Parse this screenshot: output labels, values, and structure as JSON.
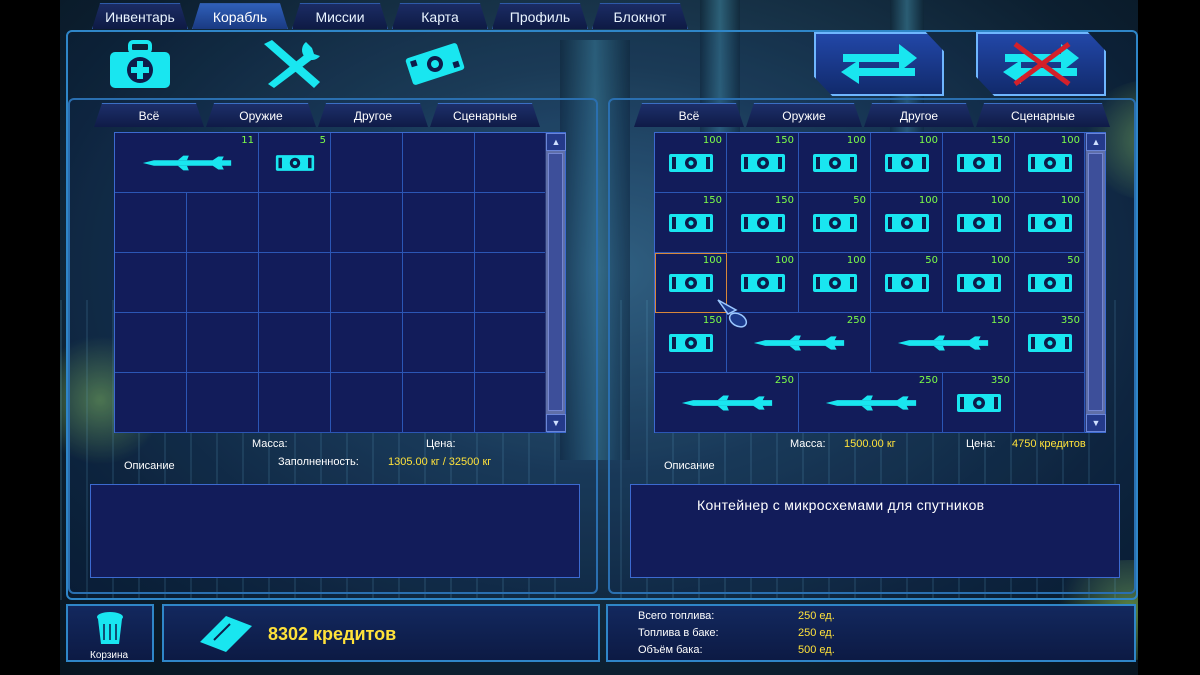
{
  "tabs": [
    "Инвентарь",
    "Корабль",
    "Миссии",
    "Карта",
    "Профиль",
    "Блокнот"
  ],
  "active_tab": "Корабль",
  "top_icons": [
    "medkit-icon",
    "tools-icon",
    "money-icon"
  ],
  "action_buttons": [
    "swap-arrows-icon",
    "swap-disabled-icon"
  ],
  "left": {
    "filters": [
      "Всё",
      "Оружие",
      "Другое",
      "Сценарные"
    ],
    "items": [
      {
        "icon": "missile-icon",
        "qty": "11"
      },
      {
        "icon": "container-icon",
        "qty": "5"
      }
    ],
    "mass_label": "Масса:",
    "price_label": "Цена:",
    "fill_label": "Заполненность:",
    "fill_value": "1305.00 кг / 32500 кг",
    "description_label": "Описание",
    "description_text": ""
  },
  "right": {
    "filters": [
      "Всё",
      "Оружие",
      "Другое",
      "Сценарные"
    ],
    "rows": [
      [
        {
          "qty": "100"
        },
        {
          "qty": "150"
        },
        {
          "qty": "100"
        },
        {
          "qty": "100"
        },
        {
          "qty": "150"
        },
        {
          "qty": "100"
        }
      ],
      [
        {
          "qty": "150"
        },
        {
          "qty": "150"
        },
        {
          "qty": "50"
        },
        {
          "qty": "100"
        },
        {
          "qty": "100"
        },
        {
          "qty": "100"
        }
      ],
      [
        {
          "qty": "100"
        },
        {
          "qty": "100"
        },
        {
          "qty": "100"
        },
        {
          "qty": "50"
        },
        {
          "qty": "100"
        },
        {
          "qty": "50"
        }
      ],
      [
        {
          "qty": "150"
        },
        {
          "qty": "250"
        },
        {
          "qty": "150"
        },
        {
          "qty": "350"
        }
      ],
      [
        {
          "qty": "250"
        },
        {
          "qty": "250"
        },
        {
          "qty": "350"
        }
      ]
    ],
    "mass_label": "Масса:",
    "mass_value": "1500.00 кг",
    "price_label": "Цена:",
    "price_value": "4750 кредитов",
    "description_label": "Описание",
    "description_text": "Контейнер с микросхемами для спутников"
  },
  "trash_label": "Корзина",
  "credits": "8302 кредитов",
  "fuel": {
    "total_label": "Всего топлива:",
    "total_value": "250 ед.",
    "tank_label": "Топлива в баке:",
    "tank_value": "250 ед.",
    "volume_label": "Объём бака:",
    "volume_value": "500 ед."
  },
  "colors": {
    "accent": "#2f86c8",
    "cyan": "#19e6f0",
    "qty": "#7dff48",
    "value": "#ffe23a",
    "panel": "#121c5a"
  }
}
